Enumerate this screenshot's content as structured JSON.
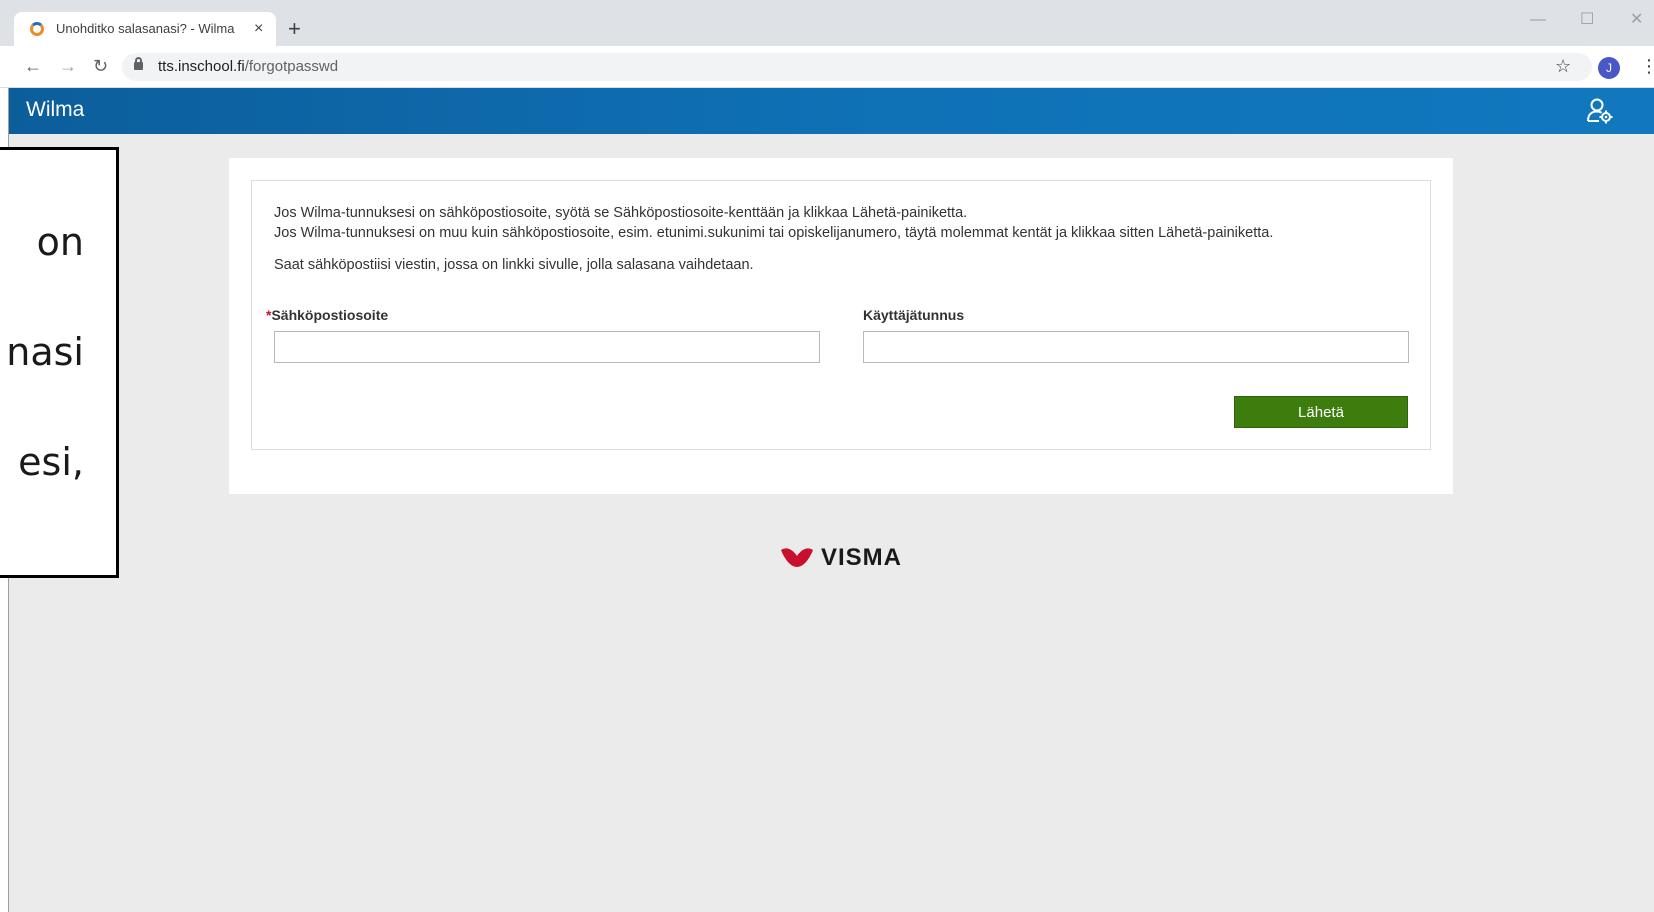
{
  "browser": {
    "tab_title": "Unohditko salasanasi? - Wilma -",
    "tab_close": "×",
    "new_tab": "+",
    "window_minimize": "—",
    "window_maximize": "☐",
    "window_close": "✕",
    "back": "←",
    "forward": "→",
    "reload": "↻",
    "url_host": "tts.inschool.fi",
    "url_path": "/forgotpasswd",
    "bookmark": "☆",
    "profile_initial": "J",
    "menu": "⋮"
  },
  "app": {
    "title": "Wilma",
    "user_icon": "user-settings-icon"
  },
  "form": {
    "intro_line_1": "Jos Wilma-tunnuksesi on sähköpostiosoite, syötä se Sähköpostiosoite-kenttään ja klikkaa Lähetä-painiketta.",
    "intro_line_2": "Jos Wilma-tunnuksesi on muu kuin sähköpostiosoite, esim. etunimi.sukunimi tai opiskelijanumero, täytä molemmat kentät ja klikkaa sitten Lähetä-painiketta.",
    "intro_line_3": "Saat sähköpostiisi viestin, jossa on linkki sivulle, jolla salasana vaihdetaan.",
    "required_marker": "*",
    "email_label": "Sähköpostiosoite",
    "email_value": "",
    "username_label": "Käyttäjätunnus",
    "username_value": "",
    "submit_label": "Lähetä"
  },
  "footer": {
    "brand": "VISMA",
    "brand_color": "#c8102e"
  },
  "callout": {
    "lines": [
      "on",
      "nasi",
      "esi,"
    ]
  },
  "colors": {
    "header_blue": "#0f72b7",
    "submit_green": "#3d7d0e",
    "page_bg": "#ebebeb"
  }
}
